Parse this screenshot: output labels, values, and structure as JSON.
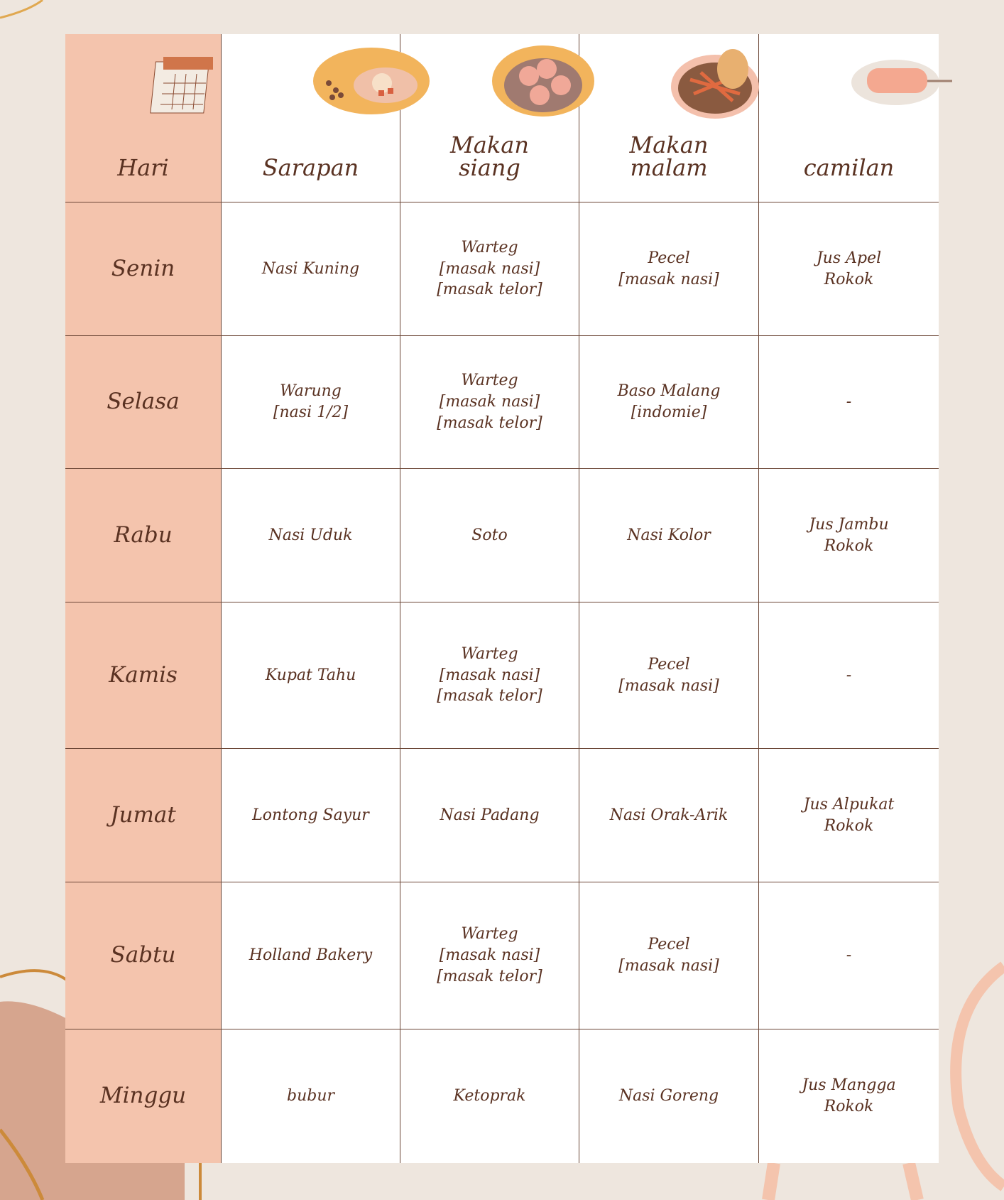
{
  "header": {
    "day": "Hari",
    "cols": [
      "Sarapan",
      "Makan siang",
      "Makan malam",
      "camilan"
    ],
    "icons": [
      "calendar-icon",
      "breakfast-plate-icon",
      "lunch-plate-icon",
      "dinner-plate-icon",
      "snack-plate-icon"
    ]
  },
  "rows": [
    {
      "day": "Senin",
      "cells": [
        "Nasi Kuning",
        "Warteg\n[masak nasi]\n[masak telor]",
        "Pecel\n[masak nasi]",
        "Jus Apel\nRokok"
      ]
    },
    {
      "day": "Selasa",
      "cells": [
        "Warung\n[nasi 1/2]",
        "Warteg\n[masak nasi]\n[masak telor]",
        "Baso Malang\n[indomie]",
        "-"
      ]
    },
    {
      "day": "Rabu",
      "cells": [
        "Nasi Uduk",
        "Soto",
        "Nasi Kolor",
        "Jus Jambu\nRokok"
      ]
    },
    {
      "day": "Kamis",
      "cells": [
        "Kupat Tahu",
        "Warteg\n[masak nasi]\n[masak telor]",
        "Pecel\n[masak nasi]",
        "-"
      ]
    },
    {
      "day": "Jumat",
      "cells": [
        "Lontong Sayur",
        "Nasi Padang",
        "Nasi Orak-Arik",
        "Jus Alpukat\nRokok"
      ]
    },
    {
      "day": "Sabtu",
      "cells": [
        "Holland Bakery",
        "Warteg\n[masak nasi]\n[masak telor]",
        "Pecel\n[masak nasi]",
        "-"
      ]
    },
    {
      "day": "Minggu",
      "cells": [
        "bubur",
        "Ketoprak",
        "Nasi Goreng",
        "Jus Mangga\nRokok"
      ]
    }
  ],
  "colors": {
    "background": "#eee6de",
    "day_column": "#f4c4ad",
    "text": "#5a3222",
    "grid": "#6b4636"
  }
}
